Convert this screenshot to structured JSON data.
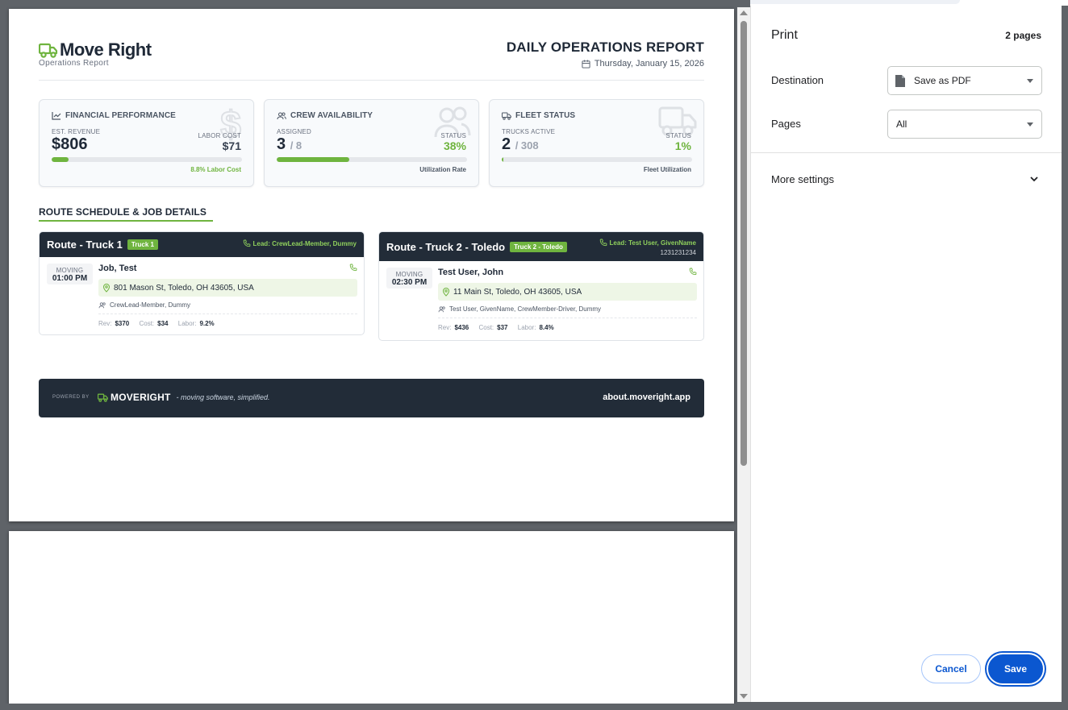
{
  "report": {
    "brand_name": "Move Right",
    "brand_sub": "Operations Report",
    "title": "DAILY OPERATIONS REPORT",
    "date": "Thursday, January 15, 2026",
    "cards": {
      "financial": {
        "title": "FINANCIAL PERFORMANCE",
        "left_label": "EST. REVENUE",
        "left_value": "$806",
        "right_label": "LABOR COST",
        "right_value": "$71",
        "progress": 0.088,
        "footer": "8.8% Labor Cost"
      },
      "crew": {
        "title": "CREW AVAILABILITY",
        "left_label": "ASSIGNED",
        "left_value": "3",
        "left_suffix": "/ 8",
        "right_label": "STATUS",
        "right_value": "38%",
        "progress": 0.38,
        "footer": "Utilization Rate"
      },
      "fleet": {
        "title": "FLEET STATUS",
        "left_label": "TRUCKS ACTIVE",
        "left_value": "2",
        "left_suffix": "/ 308",
        "right_label": "STATUS",
        "right_value": "1%",
        "progress": 0.01,
        "footer": "Fleet Utilization"
      }
    },
    "section_title": "ROUTE SCHEDULE & JOB DETAILS",
    "routes": [
      {
        "title": "Route - Truck 1",
        "tag": "Truck 1",
        "lead": "Lead: CrewLead-Member, Dummy",
        "phone": "",
        "job": {
          "kind": "MOVING",
          "time": "01:00 PM",
          "name": "Job, Test",
          "address": "801 Mason St, Toledo, OH 43605, USA",
          "crew": "CrewLead-Member, Dummy",
          "rev_label": "Rev:",
          "rev": "$370",
          "cost_label": "Cost:",
          "cost": "$34",
          "labor_label": "Labor:",
          "labor": "9.2%"
        }
      },
      {
        "title": "Route - Truck 2 - Toledo",
        "tag": "Truck 2 - Toledo",
        "lead": "Lead: Test User, GivenName",
        "phone": "1231231234",
        "job": {
          "kind": "MOVING",
          "time": "02:30 PM",
          "name": "Test User, John",
          "address": "11 Main St, Toledo, OH 43605, USA",
          "crew": "Test User, GivenName, CrewMember-Driver, Dummy",
          "rev_label": "Rev:",
          "rev": "$436",
          "cost_label": "Cost:",
          "cost": "$37",
          "labor_label": "Labor:",
          "labor": "8.4%"
        }
      }
    ],
    "footer": {
      "powered_by": "POWERED BY",
      "brand": "MOVERIGHT",
      "tagline": "- moving software, simplified.",
      "url": "about.moveright.app"
    }
  },
  "dialog": {
    "title": "Print",
    "page_count": "2 pages",
    "destination_label": "Destination",
    "destination_value": "Save as PDF",
    "pages_label": "Pages",
    "pages_value": "All",
    "more_settings": "More settings",
    "cancel": "Cancel",
    "save": "Save"
  },
  "colors": {
    "accent_green": "#6fb43f",
    "dark_navy": "#222c38",
    "chrome_blue": "#0b57d0"
  }
}
